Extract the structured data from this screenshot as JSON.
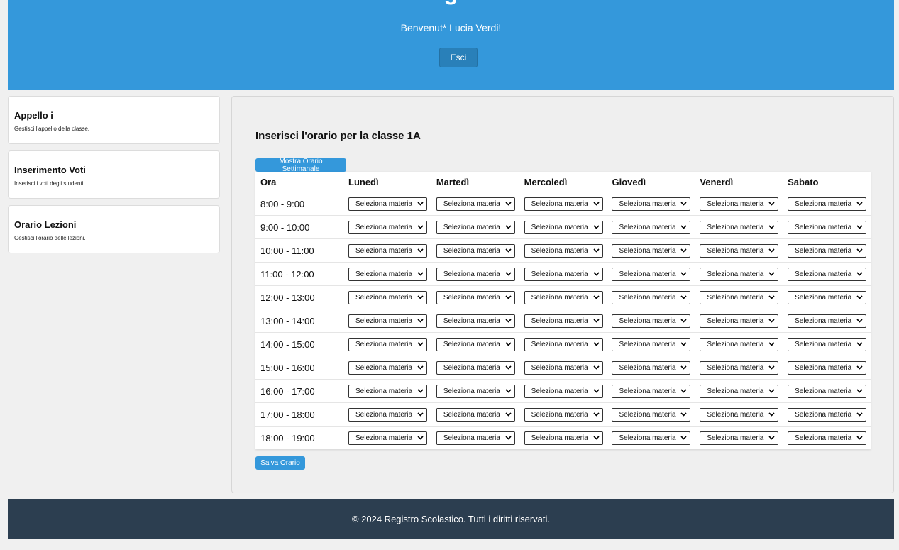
{
  "header": {
    "title_fragment": "g",
    "welcome": "Benvenut* Lucia Verdi!",
    "logout_label": "Esci"
  },
  "sidebar": {
    "cards": [
      {
        "title": "Appello i",
        "desc": "Gestisci l'appello della classe."
      },
      {
        "title": "Inserimento Voti",
        "desc": "Inserisci i voti degli studenti."
      },
      {
        "title": "Orario Lezioni",
        "desc": "Gestisci l'orario delle lezioni."
      }
    ]
  },
  "main": {
    "title": "Inserisci l'orario per la classe 1A",
    "show_button": "Mostra Orario Settimanale",
    "save_button": "Salva Orario",
    "columns": [
      "Ora",
      "Lunedì",
      "Martedì",
      "Mercoledì",
      "Giovedì",
      "Venerdì",
      "Sabato"
    ],
    "select_placeholder": "Seleziona materia",
    "hours": [
      "8:00 - 9:00",
      "9:00 - 10:00",
      "10:00 - 11:00",
      "11:00 - 12:00",
      "12:00 - 13:00",
      "13:00 - 14:00",
      "14:00 - 15:00",
      "15:00 - 16:00",
      "16:00 - 17:00",
      "17:00 - 18:00",
      "18:00 - 19:00"
    ]
  },
  "footer": {
    "text": "© 2024 Registro Scolastico. Tutti i diritti riservati."
  },
  "colors": {
    "header": "#3498db",
    "button": "#3498db",
    "footer": "#2c3e50"
  }
}
